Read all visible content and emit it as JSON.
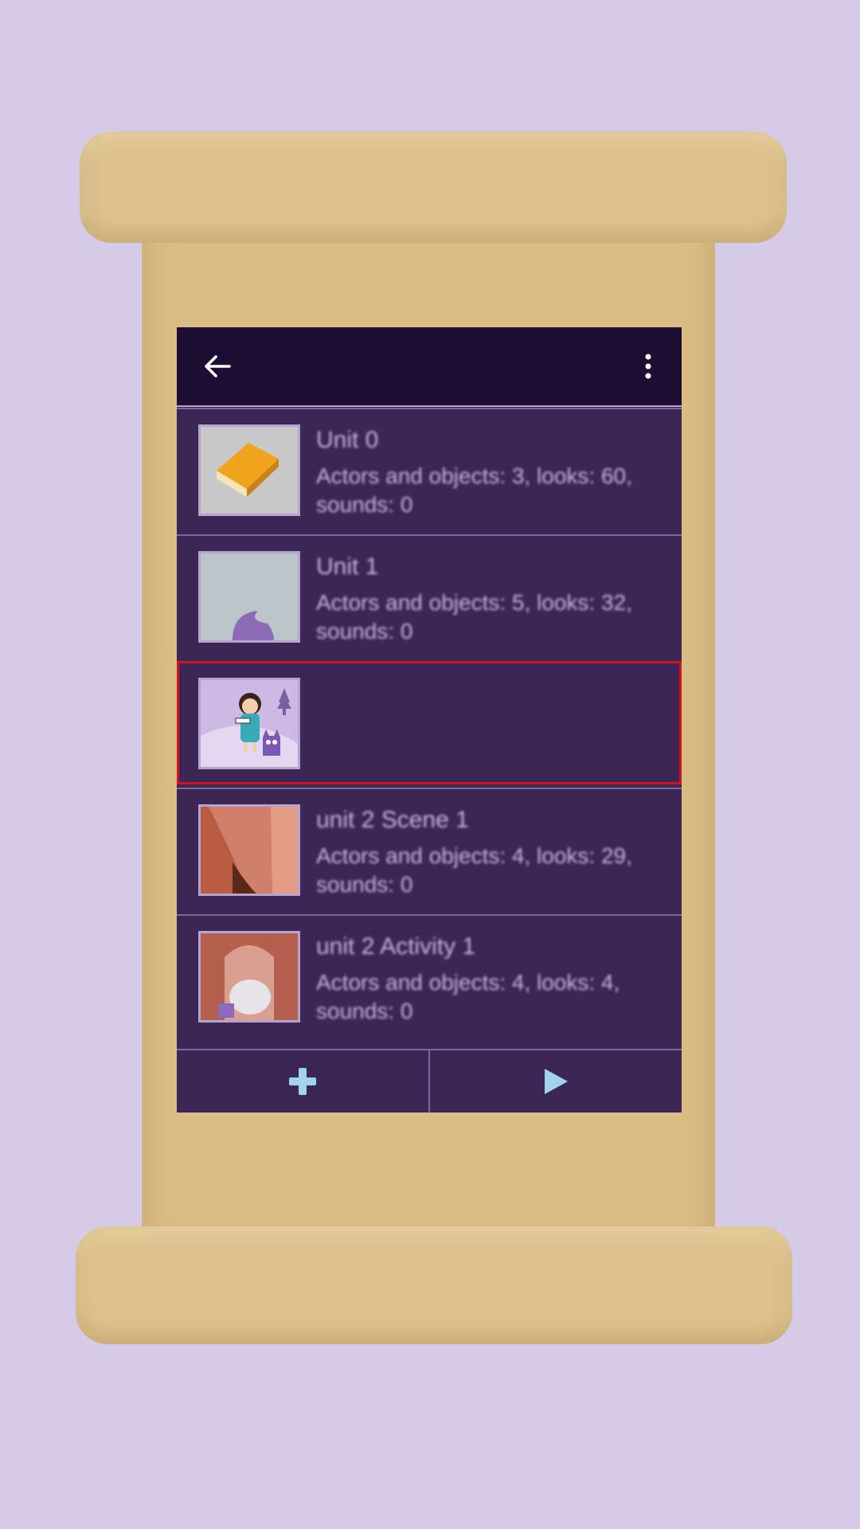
{
  "toolbar": {
    "back_icon": "back-arrow-icon",
    "menu_icon": "more-vert-icon"
  },
  "scenes": [
    {
      "title": "Unit 0",
      "description": "Actors and objects: 3, looks: 60, sounds: 0",
      "thumbnail": "book-icon"
    },
    {
      "title": "Unit 1",
      "description": "Actors and objects: 5, looks: 32, sounds: 0",
      "thumbnail": "purple-wave-thumbnail"
    },
    {
      "title": "",
      "description": "",
      "thumbnail": "girl-and-cat-thumbnail",
      "selected": true
    },
    {
      "title": "unit 2 Scene 1",
      "description": "Actors and objects: 4, looks: 29, sounds: 0",
      "thumbnail": "brick-wall-thumbnail"
    },
    {
      "title": "unit 2 Activity 1",
      "description": "Actors and objects: 4, looks: 4, sounds: 0",
      "thumbnail": "cave-thumbnail"
    }
  ],
  "bottom_bar": {
    "add_icon": "plus-icon",
    "play_icon": "play-icon"
  },
  "colors": {
    "background": "#d5cbe8",
    "toolbar": "#1d0f33",
    "list_bg": "#3b2656",
    "selection": "#d3141f",
    "accent_icon": "#9fd3ee"
  }
}
